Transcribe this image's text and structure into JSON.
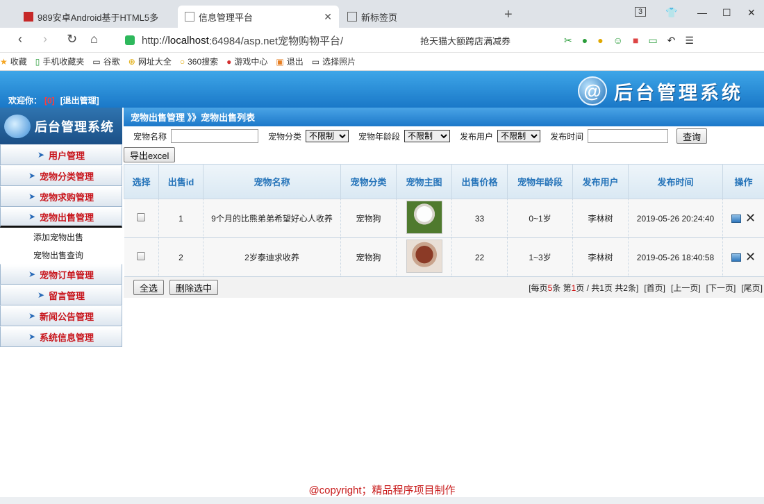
{
  "browser": {
    "tabs": [
      {
        "label": "989安卓Android基于HTML5多",
        "active": false
      },
      {
        "label": "信息管理平台",
        "active": true
      },
      {
        "label": "新标签页",
        "active": false
      }
    ],
    "tab_count": "3",
    "url_scheme": "http://",
    "url_host": "localhost",
    "url_rest": ":64984/asp.net宠物购物平台/",
    "url_promo": "抢天猫大额跨店满减券",
    "bookmarks": [
      "收藏",
      "手机收藏夹",
      "谷歌",
      "网址大全",
      "360搜索",
      "游戏中心",
      "退出",
      "选择照片"
    ]
  },
  "header": {
    "welcome": "欢迎你：",
    "user": "[0]",
    "logout": "[退出管理]",
    "brand_logo": "@",
    "brand_title": "后台管理系统"
  },
  "sidebar": {
    "logo_title": "后台管理系统",
    "items": [
      {
        "label": "用户管理"
      },
      {
        "label": "宠物分类管理"
      },
      {
        "label": "宠物求购管理"
      },
      {
        "label": "宠物出售管理"
      }
    ],
    "sub_items": [
      "添加宠物出售",
      "宠物出售查询"
    ],
    "items_after": [
      {
        "label": "宠物订单管理"
      },
      {
        "label": "留言管理"
      },
      {
        "label": "新闻公告管理"
      },
      {
        "label": "系统信息管理"
      }
    ]
  },
  "breadcrumb": "宠物出售管理 》》宠物出售列表",
  "filter": {
    "name_label": "宠物名称",
    "category_label": "宠物分类",
    "category_value": "不限制",
    "age_label": "宠物年龄段",
    "age_value": "不限制",
    "user_label": "发布用户",
    "user_value": "不限制",
    "time_label": "发布时间",
    "query_button": "查询"
  },
  "export_button": "导出excel",
  "table": {
    "headers": [
      "选择",
      "出售id",
      "宠物名称",
      "宠物分类",
      "宠物主图",
      "出售价格",
      "宠物年龄段",
      "发布用户",
      "发布时间",
      "操作"
    ],
    "rows": [
      {
        "id": "1",
        "name": "9个月的比熊弟弟希望好心人收养",
        "category": "宠物狗",
        "price": "33",
        "age": "0~1岁",
        "user": "李林树",
        "time": "2019-05-26 20:24:40"
      },
      {
        "id": "2",
        "name": "2岁泰迪求收养",
        "category": "宠物狗",
        "price": "22",
        "age": "1~3岁",
        "user": "李林树",
        "time": "2019-05-26 18:40:58"
      }
    ]
  },
  "actions": {
    "select_all": "全选",
    "delete_selected": "删除选中"
  },
  "pager": {
    "prefix": "[每页",
    "per_page": "5",
    "mid1": "条 第",
    "current": "1",
    "mid2": "页 / 共1页 共2条]",
    "first": "[首页]",
    "prev": "[上一页]",
    "next": "[下一页]",
    "last": "[尾页]"
  },
  "footer": "@copyright；精品程序项目制作",
  "colors": {
    "header_blue": "#1a78c8",
    "menu_red": "#c8151c",
    "table_header_text": "#2473b9",
    "footer_red": "#c81a1a"
  }
}
